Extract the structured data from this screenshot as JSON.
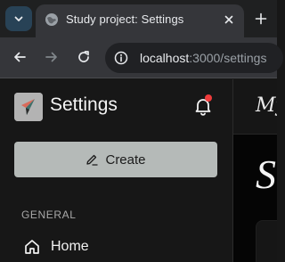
{
  "browser": {
    "tab": {
      "title": "Study project: Settings"
    },
    "address_bar": {
      "host": "localhost",
      "rest": ":3000/settings"
    },
    "icons": {
      "tab_search": "chevron-down-icon",
      "favicon": "globe-icon",
      "close": "close-icon",
      "new_tab": "plus-icon",
      "back": "arrow-left-icon",
      "forward": "arrow-right-icon",
      "reload": "reload-icon",
      "site_info": "info-icon"
    }
  },
  "sidebar": {
    "title": "Settings",
    "create_label": "Create",
    "section_label": "GENERAL",
    "nav_items": [
      {
        "label": "Home",
        "icon": "home-icon"
      }
    ],
    "notification_badge_color": "#ef3b3b"
  },
  "main": {
    "header_text": "My",
    "heading": "S"
  },
  "colors": {
    "accent_button": "#b5bab8",
    "tab_search_bg": "#284256",
    "sidebar_bg": "#171717"
  }
}
